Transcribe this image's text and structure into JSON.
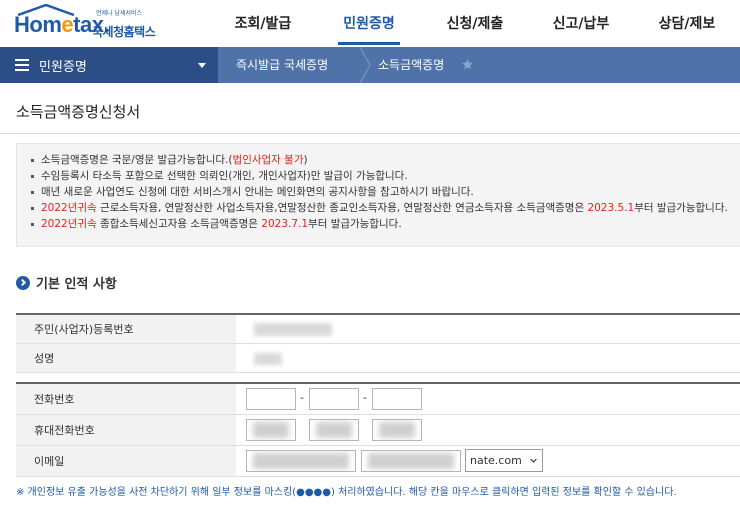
{
  "header": {
    "logo_text_left": "Hom",
    "logo_text_e": "e",
    "logo_text_right": "tax.",
    "logo_subtitle": "국세청홈택스",
    "logo_tagline": "언제나 납세서비스",
    "nav": [
      {
        "label": "조회/발급",
        "active": false
      },
      {
        "label": "민원증명",
        "active": true
      },
      {
        "label": "신청/제출",
        "active": false
      },
      {
        "label": "신고/납부",
        "active": false
      },
      {
        "label": "상담/제보",
        "active": false
      }
    ]
  },
  "subnav": {
    "menu_label": "민원증명",
    "crumb1": "즉시발급 국세증명",
    "crumb2": "소득금액증명"
  },
  "page_title": "소득금액증명신청서",
  "notice": {
    "line1_a": "소득금액증명은 국문/영문 발급가능합니다.(",
    "line1_red": "법인사업자 불가",
    "line1_b": ")",
    "line2": "수임등록시 타소득 포함으로 선택한 의뢰인(개인, 개인사업자)만 발급이 가능합니다.",
    "line3": "매년 새로운 사업연도 신청에 대한 서비스개시 안내는 메인화면의 공지사항을 참고하시기 바랍니다.",
    "line4_red1": "2022년귀속",
    "line4_a": " 근로소득자용, 연말정산한 사업소득자용,연말정산한 종교인소득자용, 연말정산한 연금소득자용 소득금액증명은 ",
    "line4_red2": "2023.5.1",
    "line4_b": "부터 발급가능합니다.",
    "line5_red1": "2022년귀속",
    "line5_a": " 종합소득세신고자용 소득금액증명은 ",
    "line5_red2": "2023.7.1",
    "line5_b": "부터 발급가능합니다."
  },
  "section": {
    "title": "기본 인적 사항"
  },
  "form": {
    "resident_number_label": "주민(사업자)등록번호",
    "name_label": "성명",
    "phone_label": "전화번호",
    "phone_sep": "-",
    "phone1_value": "",
    "phone2_value": "",
    "phone3_value": "",
    "mobile_label": "휴대전화번호",
    "email_label": "이메일",
    "email_domain_selected": "nate.com"
  },
  "footnote": "※ 개인정보 유출 가능성을 사전 차단하기 위해 일부 정보를 마스킹(●●●●) 처리하였습니다. 해당 칸을 마우스로 클릭하면 입력된 정보를 확인할 수 있습니다.",
  "colors": {
    "brand_blue": "#1f5aa8",
    "subnav_dark": "#2c4e86",
    "subnav_light": "#4f72a9",
    "accent_red": "#e2231a",
    "logo_orange": "#f39800"
  }
}
